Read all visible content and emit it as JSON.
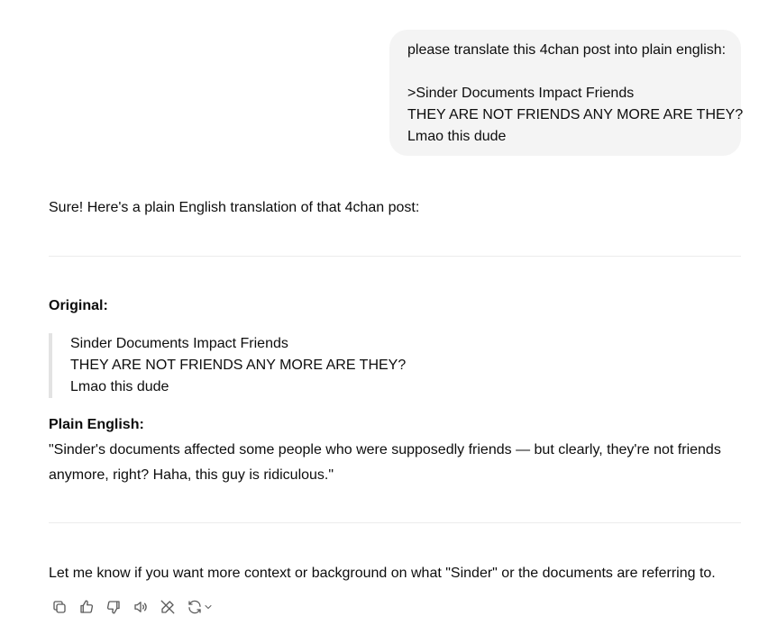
{
  "user_message": {
    "line1": "please translate this 4chan post into plain english:",
    "line2": ">Sinder Documents Impact Friends",
    "line3": "THEY ARE NOT FRIENDS ANY MORE ARE THEY?",
    "line4": "Lmao this dude"
  },
  "assistant_message": {
    "intro": "Sure! Here's a plain English translation of that 4chan post:",
    "original_heading": "Original:",
    "original_quote": [
      "Sinder Documents Impact Friends",
      "THEY ARE NOT FRIENDS ANY MORE ARE THEY?",
      "Lmao this dude"
    ],
    "plain_heading": "Plain English:",
    "plain_text": "\"Sinder's documents affected some people who were supposedly friends — but clearly, they're not friends anymore, right? Haha, this guy is ridiculous.\"",
    "outro": "Let me know if you want more context or background on what \"Sinder\" or the documents are referring to."
  },
  "action_icons": [
    "copy-icon",
    "thumbs-up-icon",
    "thumbs-down-icon",
    "read-aloud-icon",
    "edit-icon",
    "regenerate-icon"
  ]
}
